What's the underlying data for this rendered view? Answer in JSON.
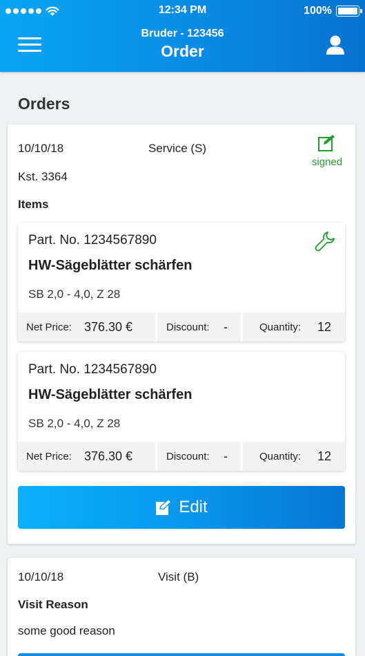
{
  "status_bar": {
    "time": "12:34 PM",
    "battery": "100%"
  },
  "nav": {
    "subtitle": "Bruder - 123456",
    "title": "Order"
  },
  "section_title": "Orders",
  "orders": [
    {
      "date": "10/10/18",
      "type": "Service (S)",
      "signed_label": "signed",
      "cost_center": "Kst. 3364",
      "items_label": "Items",
      "items": [
        {
          "part_no": "Part. No. 1234567890",
          "name": "HW-Sägeblätter schärfen",
          "description": "SB 2,0 - 4,0, Z 28",
          "net_price_label": "Net Price:",
          "net_price": "376.30 €",
          "discount_label": "Discount:",
          "discount": "-",
          "quantity_label": "Quantity:",
          "quantity": "12"
        },
        {
          "part_no": "Part. No. 1234567890",
          "name": "HW-Sägeblätter schärfen",
          "description": "SB 2,0 - 4,0, Z 28",
          "net_price_label": "Net Price:",
          "net_price": "376.30 €",
          "discount_label": "Discount:",
          "discount": "-",
          "quantity_label": "Quantity:",
          "quantity": "12"
        }
      ],
      "edit_label": "Edit"
    },
    {
      "date": "10/10/18",
      "type": "Visit (B)",
      "visit_reason_label": "Visit Reason",
      "visit_reason": "some good reason"
    }
  ],
  "icons": {
    "menu": "hamburger-icon",
    "profile": "user-icon",
    "signed": "edit-square-icon",
    "item": "wrench-icon",
    "edit": "pencil-square-icon"
  },
  "colors": {
    "header_blue": "#0a8be4",
    "signed_green": "#1f9e2e",
    "button_blue": "#0a98ee",
    "background": "#eff0f2"
  }
}
